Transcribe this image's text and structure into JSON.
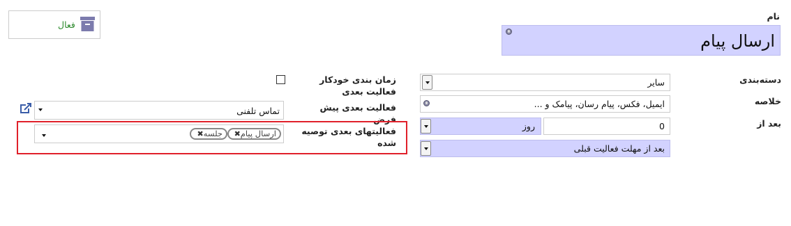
{
  "status_button": {
    "label": "فعال"
  },
  "name": {
    "label": "نام",
    "value": "ارسال پیام"
  },
  "category": {
    "label": "دسته‌بندی",
    "value": "سایر"
  },
  "summary": {
    "label": "خلاصه",
    "value": "ایمیل، فکس، پیام رسان، پیامک و ..."
  },
  "after": {
    "label": "بعد از",
    "number": "0",
    "unit": "روز",
    "relative_to": "بعد از مهلت فعالیت قبلی"
  },
  "auto_schedule": {
    "label": "زمان بندی خودکار فعالیت بعدی",
    "checked": false
  },
  "default_next": {
    "label": "فعالیت بعدی پیش فرض",
    "value": "تماس تلفنی"
  },
  "recommended_next": {
    "label": "فعالیتهای بعدی توصیه شده",
    "tags": [
      "ارسال پیام",
      "جلسه"
    ]
  },
  "colors": {
    "required_bg": "#d2d2ff",
    "active_green": "#2e8b2e",
    "highlight_red": "#e0202a",
    "archive_icon": "#7c7bad"
  },
  "icons": [
    "archive-icon",
    "globe-icon",
    "external-link-icon",
    "tag-remove-icon",
    "caret-down-icon"
  ]
}
